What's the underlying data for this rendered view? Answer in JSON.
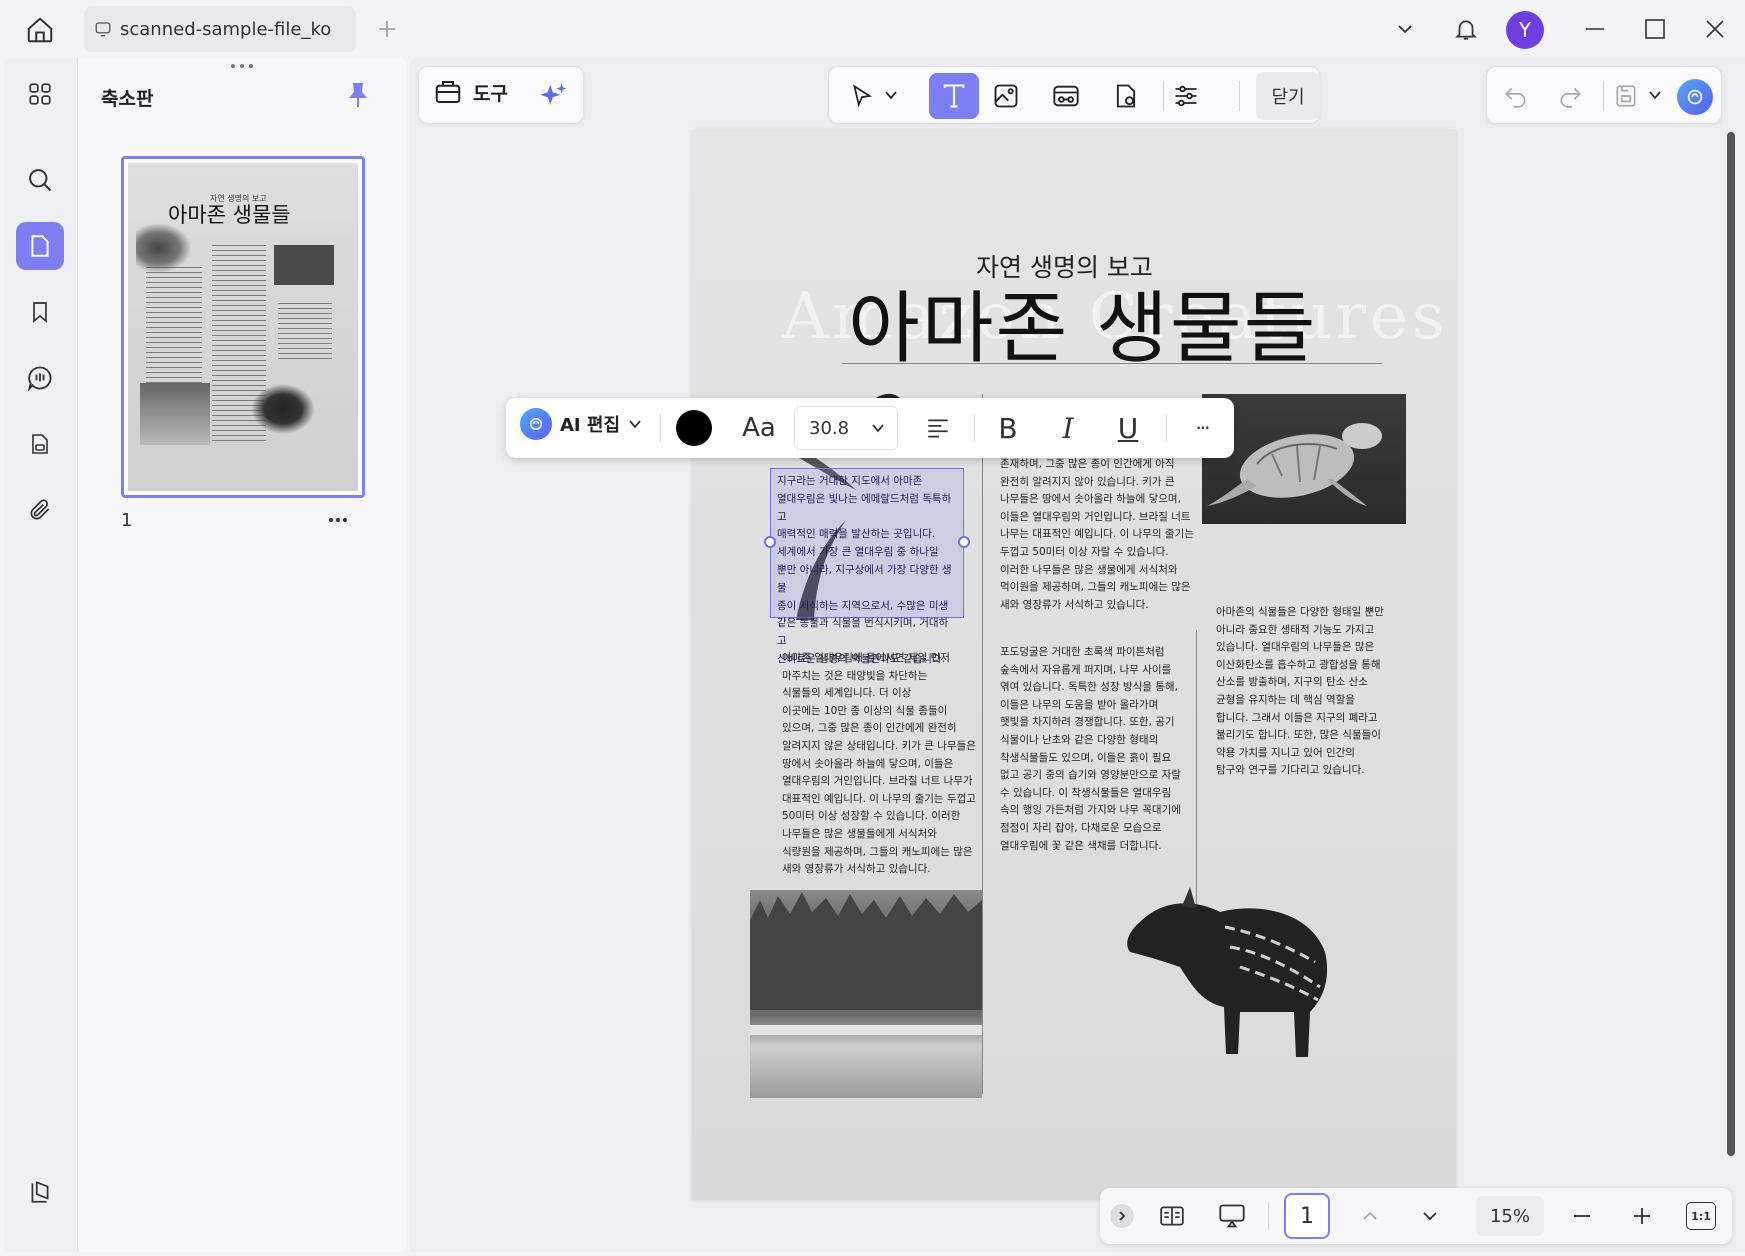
{
  "window": {
    "tab_title": "scanned-sample-file_ko",
    "avatar_letter": "Y"
  },
  "sidebar": {
    "panel_title": "축소판",
    "thumbnail": {
      "page_number": "1",
      "subtitle": "자연 생명의 보고",
      "title": "아마존 생물들"
    }
  },
  "toolbar": {
    "tools_label": "도구",
    "close_label": "닫기"
  },
  "format_toolbar": {
    "ai_edit_label": "AI 편집",
    "font_size": "30.8",
    "font_label": "Aa",
    "bold": "B",
    "italic": "I",
    "underline": "U",
    "more": "···"
  },
  "document": {
    "ghost_title": "Amazon Creatures",
    "subtitle": "자연 생명의 보고",
    "title": "아마존 생물들",
    "selected_paragraph": "지구라는 거대한 지도에서 아마존\n열대우림은 빛나는 에메랄드처럼 독특하고\n매력적인 매력을 발산하는 곳입니다.\n세계에서 가장 큰 열대우림 중 하나일\n뿐만 아니라, 지구상에서 가장 다양한 생물\n종이 서식하는 지역으로서, 수많은 미생\n같은 동물과 식물을 번식시키며, 거대하고\n신비로운 생명의 박물관과도 같습니다.",
    "col1_paragraph": "아마존 열대우림에 들어서면 제일 먼저\n마주치는 것은 태양빛을 차단하는\n식물들의 세계입니다. 더 이상\n이곳에는 10만 종 이상의 식물 종들이\n있으며, 그중 많은 종이 인간에게 완전히\n알려지지 않은 상태입니다. 키가 큰 나무들은\n땅에서 솟아올라 하늘에 닿으며, 이들은\n열대우림의 거인입니다. 브라질 너트 나무가\n대표적인 예입니다. 이 나무의 줄기는 두껍고\n50미터 이상 성장할 수 있습니다. 이러한\n나무들은 많은 생물들에게 서식처와\n식량원을 제공하며, 그들의 캐노피에는 많은\n새와 영장류가 서식하고 있습니다.",
    "col2_top": "존재하며, 그중 많은 종이 인간에게 아직\n완전히 알려지지 않아 있습니다. 키가 큰\n나무들은 땅에서 솟아올라 하늘에 닿으며,\n이들은 열대우림의 거인입니다. 브라질 너트\n나무는 대표적인 예입니다. 이 나무의 줄기는\n두껍고 50미터 이상 자랄 수 있습니다.\n이러한 나무들은 많은 생물에게 서식처와\n먹이원을 제공하며, 그들의 캐노피에는 많은\n새와 영장류가 서식하고 있습니다.",
    "col2_bottom": "포도덩굴은 거대한 초록색 파이톤처럼\n숲속에서 자유롭게 퍼지며, 나무 사이를\n엮여 있습니다. 독특한 성장 방식을 통해,\n이들은 나무의 도움을 받아 올라가며\n햇빛을 차지하려 경쟁합니다. 또한, 공기\n식물이나 난초와 같은 다양한 형태의\n착생식물들도 있으며, 이들은 흙이 필요\n없고 공기 중의 습기와 영양분만으로 자랄\n수 있습니다. 이 착생식물들은 열대우림\n속의 행잉 가든처럼 가지와 나무 꼭대기에\n점점이 자리 잡아, 다채로운 모습으로\n열대우림에 꽃 같은 색채를 더합니다.",
    "col3_paragraph": "아마존의 식물들은 다양한 형태일 뿐만\n아니라 중요한 생태적 기능도 가지고\n있습니다. 열대우림의 나무들은 많은\n이산화탄소를 흡수하고 광합성을 통해\n산소를 방출하며, 지구의 탄소 산소\n균형을 유지하는 데 핵심 역할을\n합니다. 그래서 이들은 지구의 폐라고\n불리기도 합니다. 또한, 많은 식물들이\n약용 가치를 지니고 있어 인간의\n탐구와 연구를 기다리고 있습니다."
  },
  "bottom_bar": {
    "current_page": "1",
    "zoom": "15%",
    "actual_size_label": "1:1"
  },
  "colors": {
    "accent": "#7b7ff2",
    "selection": "#6b6ff0"
  }
}
